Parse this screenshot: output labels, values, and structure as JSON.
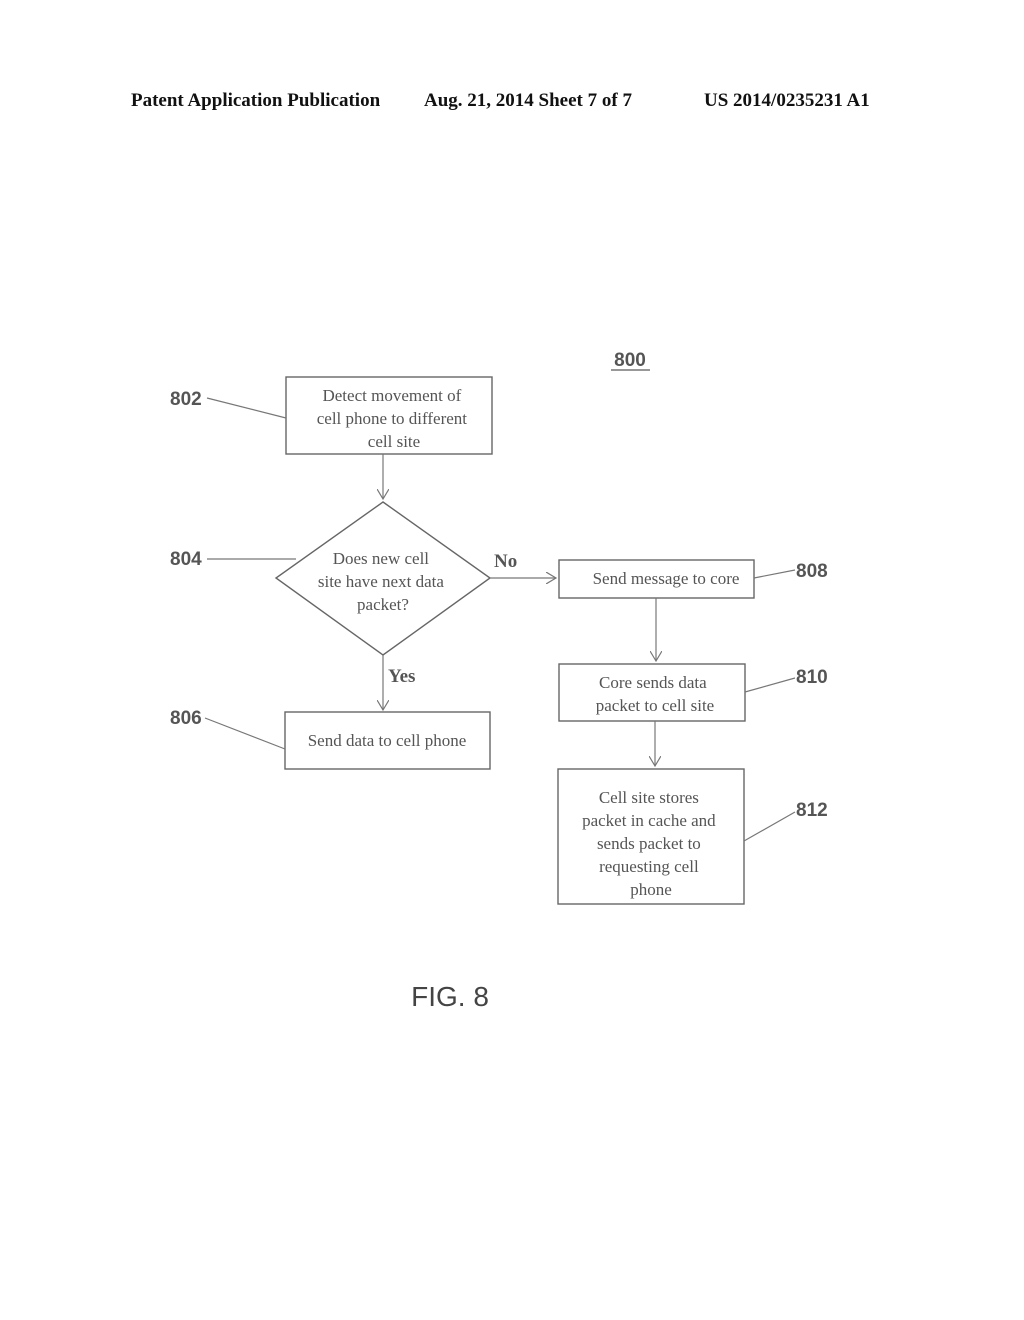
{
  "header": {
    "publication": "Patent Application Publication",
    "date_sheet": "Aug. 21, 2014  Sheet 7 of 7",
    "number": "US 2014/0235231 A1"
  },
  "diagram": {
    "id_label": "800",
    "figure_label": "FIG. 8",
    "nodes": [
      {
        "ref": "802",
        "type": "process",
        "lines": [
          "Detect movement of",
          "cell phone to different",
          "cell site"
        ]
      },
      {
        "ref": "804",
        "type": "decision",
        "lines": [
          "Does new cell",
          "site have next data",
          "packet?"
        ]
      },
      {
        "ref": "806",
        "type": "process",
        "lines": [
          "Send data to cell phone"
        ]
      },
      {
        "ref": "808",
        "type": "process",
        "lines": [
          "Send message to core"
        ]
      },
      {
        "ref": "810",
        "type": "process",
        "lines": [
          "Core sends data",
          "packet to cell site"
        ]
      },
      {
        "ref": "812",
        "type": "process",
        "lines": [
          "Cell site stores",
          "packet in cache and",
          "sends packet to",
          "requesting cell",
          "phone"
        ]
      }
    ],
    "edges": [
      {
        "from": "802",
        "to": "804",
        "label": ""
      },
      {
        "from": "804",
        "to": "808",
        "label": "No"
      },
      {
        "from": "804",
        "to": "806",
        "label": "Yes"
      },
      {
        "from": "808",
        "to": "810",
        "label": ""
      },
      {
        "from": "810",
        "to": "812",
        "label": ""
      }
    ]
  }
}
